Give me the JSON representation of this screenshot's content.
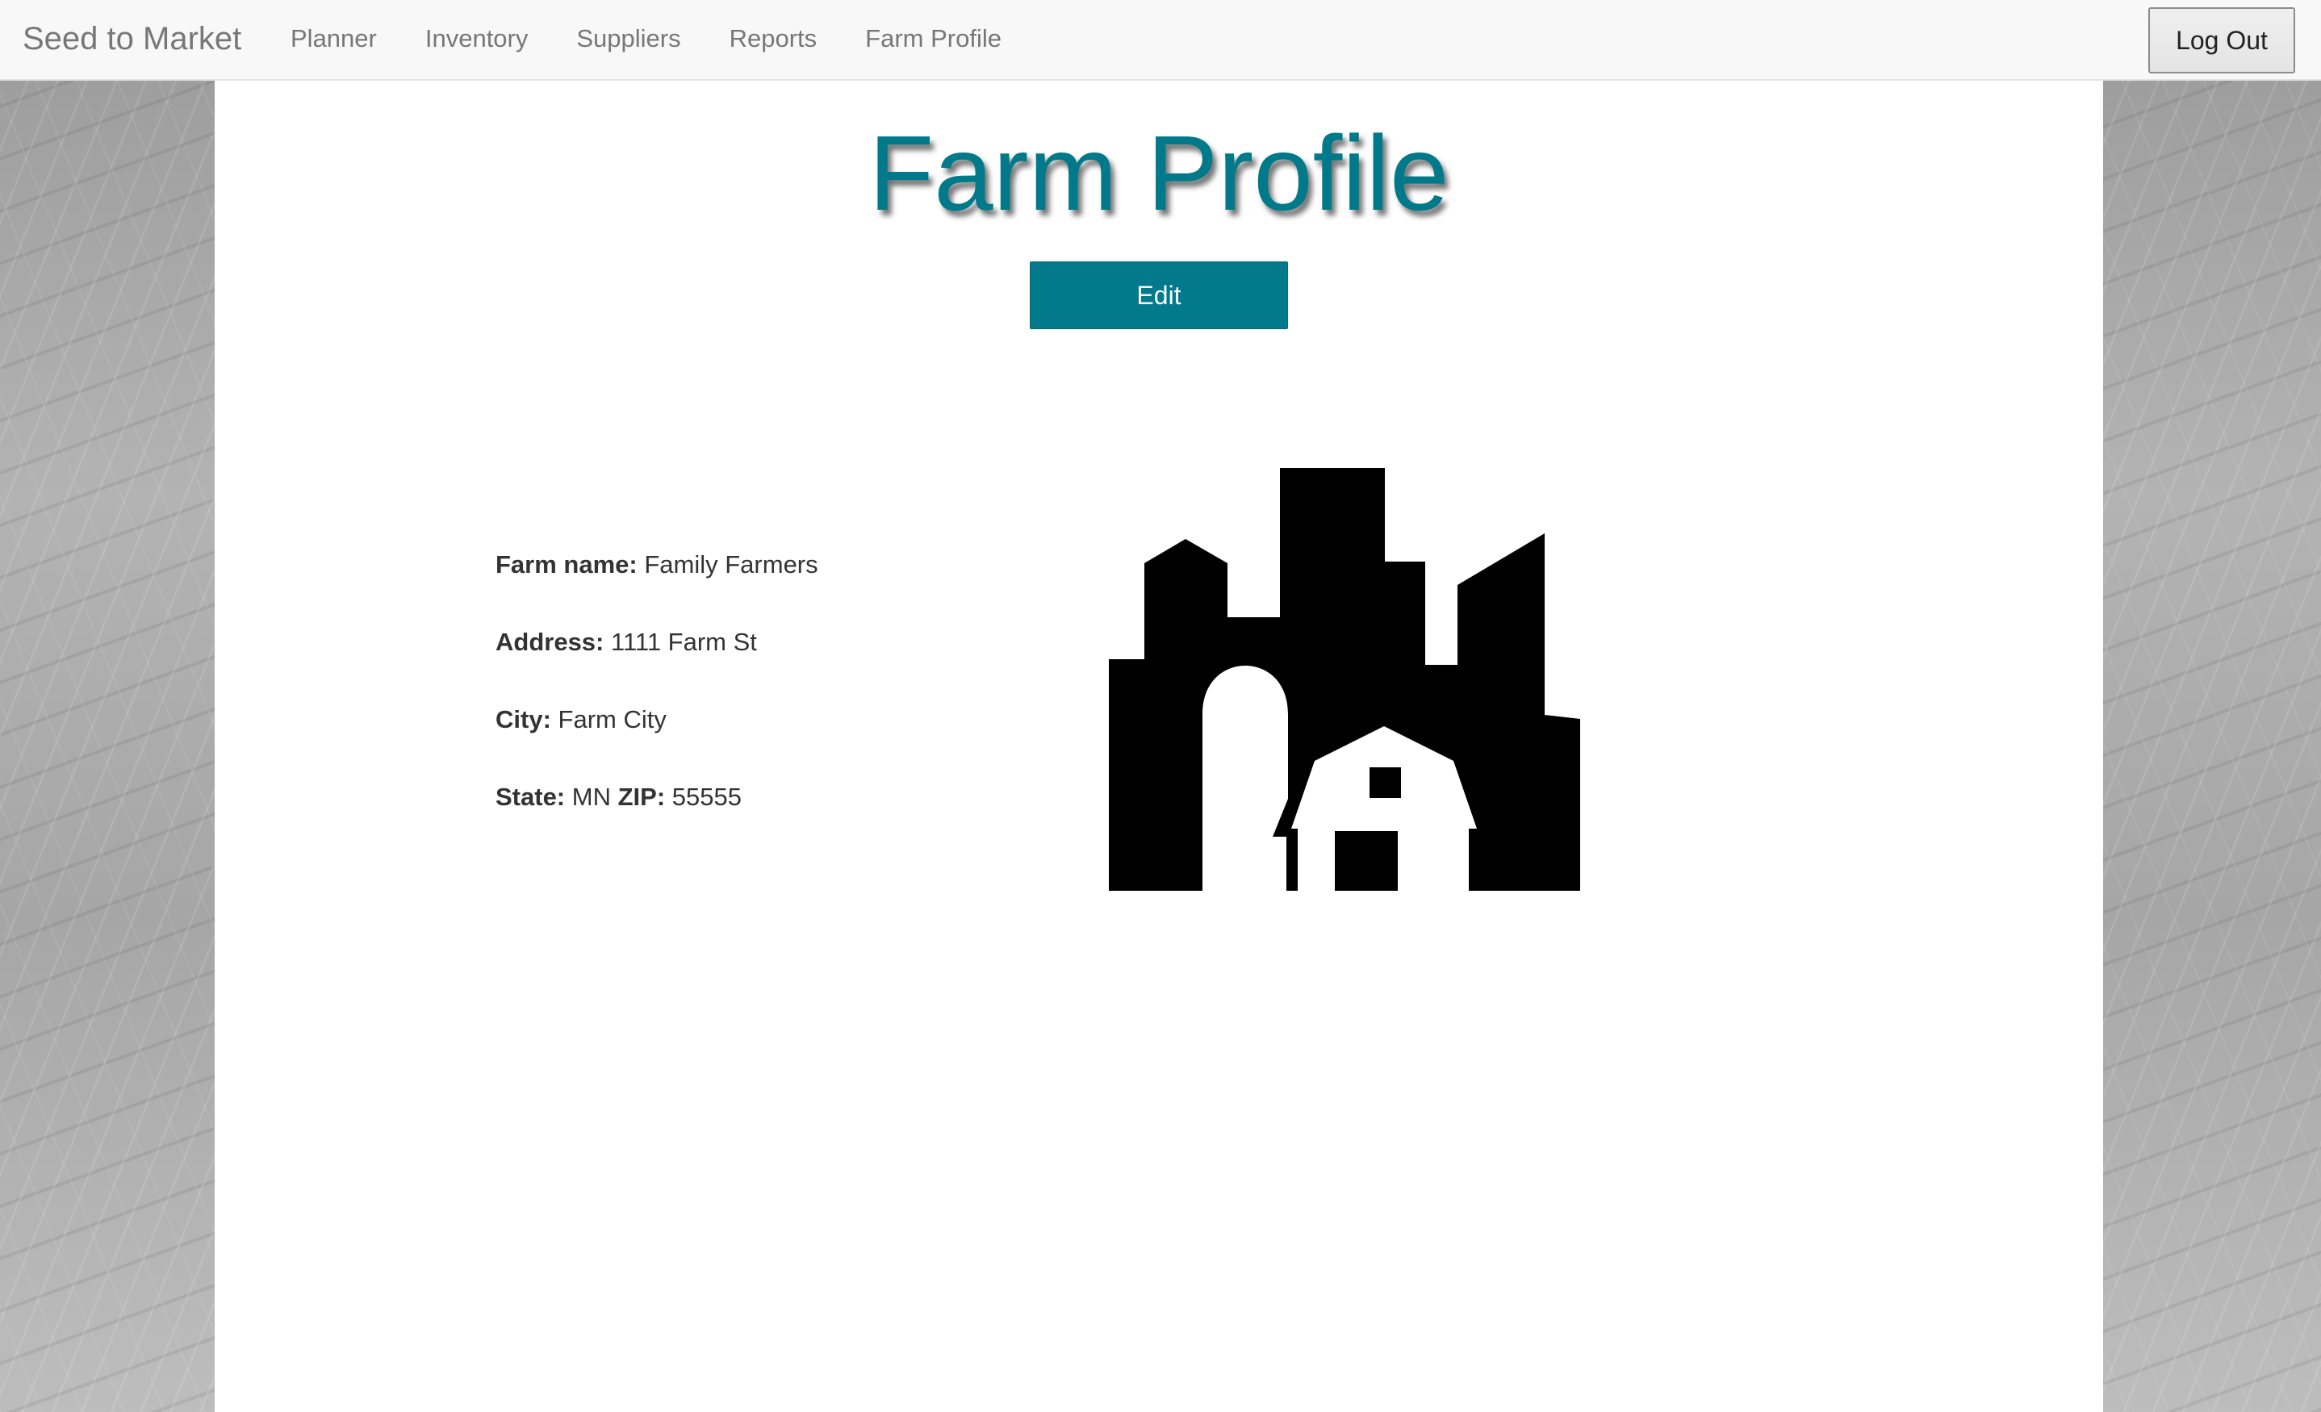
{
  "navbar": {
    "brand": "Seed to Market",
    "links": [
      "Planner",
      "Inventory",
      "Suppliers",
      "Reports",
      "Farm Profile"
    ],
    "logout_label": "Log Out"
  },
  "page": {
    "title": "Farm Profile",
    "edit_label": "Edit"
  },
  "profile": {
    "farm_name_label": "Farm name:",
    "farm_name": "Family Farmers",
    "address_label": "Address:",
    "address": "1111 Farm St",
    "city_label": "City:",
    "city": "Farm City",
    "state_label": "State:",
    "state": "MN",
    "zip_label": "ZIP:",
    "zip": "55555"
  },
  "icons": {
    "farm_illustration": "farm-barn-silo-icon"
  },
  "colors": {
    "accent": "#027a8b",
    "title": "#007a8a",
    "navbar_bg": "#f8f8f8",
    "nav_text": "#777777"
  }
}
